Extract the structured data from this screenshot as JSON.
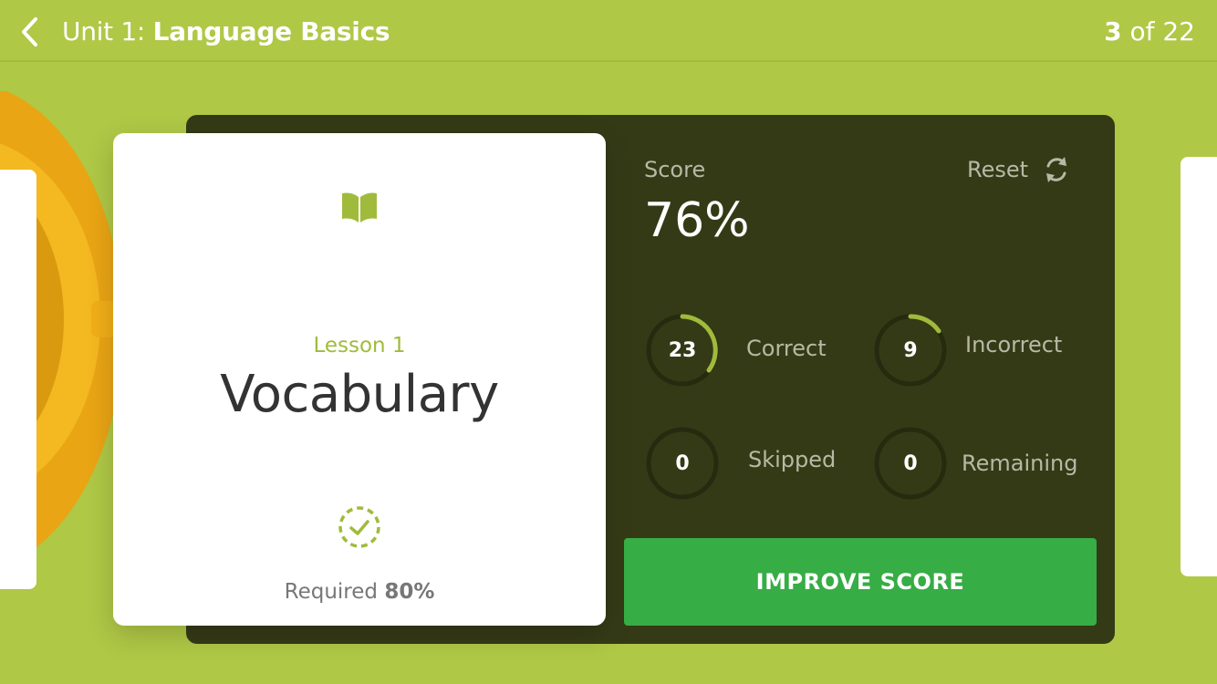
{
  "header": {
    "unit_prefix": "Unit 1:",
    "unit_name": "Language Basics",
    "page_current": "3",
    "page_sep_total": "of 22"
  },
  "lesson": {
    "label": "Lesson 1",
    "title": "Vocabulary",
    "required_label": "Required",
    "required_value": "80%"
  },
  "score": {
    "label": "Score",
    "value": "76%",
    "reset_label": "Reset"
  },
  "stats": {
    "correct": {
      "value": "23",
      "label": "Correct"
    },
    "incorrect": {
      "value": "9",
      "label": "Incorrect"
    },
    "skipped": {
      "value": "0",
      "label": "Skipped"
    },
    "remaining": {
      "value": "0",
      "label": "Remaining"
    }
  },
  "actions": {
    "improve_label": "IMPROVE SCORE"
  },
  "icons": [
    "back-chevron-icon",
    "book-icon",
    "check-dashed-circle-icon",
    "refresh-icon"
  ],
  "colors": {
    "background": "#afc846",
    "panel": "#353a16",
    "accent": "#a0bb3c",
    "button": "#36ad45"
  }
}
